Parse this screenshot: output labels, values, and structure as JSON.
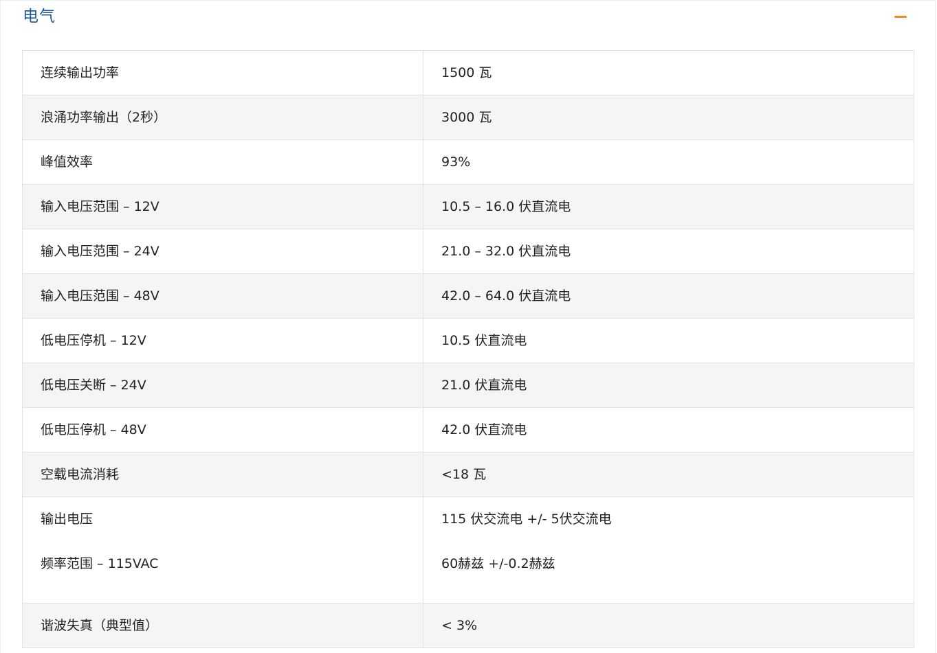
{
  "section": {
    "title": "电气",
    "toggle_icon": "minus-icon",
    "accent_color": "#f08a24",
    "title_color": "#1e5e9e"
  },
  "specs": [
    {
      "label": "连续输出功率",
      "value": "1500 瓦"
    },
    {
      "label": "浪涌功率输出（2秒）",
      "value": "3000 瓦"
    },
    {
      "label": "峰值效率",
      "value": "93%"
    },
    {
      "label": "输入电压范围 – 12V",
      "value": "10.5 – 16.0 伏直流电"
    },
    {
      "label": "输入电压范围 – 24V",
      "value": "21.0 – 32.0 伏直流电"
    },
    {
      "label": "输入电压范围 – 48V",
      "value": "42.0 – 64.0 伏直流电"
    },
    {
      "label": "低电压停机 – 12V",
      "value": "10.5 伏直流电"
    },
    {
      "label": "低电压关断 – 24V",
      "value": "21.0 伏直流电"
    },
    {
      "label": "低电压停机 – 48V",
      "value": "42.0 伏直流电"
    },
    {
      "label": "空载电流消耗",
      "value": "<18 瓦"
    },
    {
      "label": "输出电压",
      "value": "115 伏交流电 +/- 5伏交流电",
      "label2": "频率范围 – 115VAC",
      "value2": "60赫兹 +/-0.2赫兹"
    },
    {
      "label": "谐波失真（典型值）",
      "value": "< 3%"
    }
  ]
}
